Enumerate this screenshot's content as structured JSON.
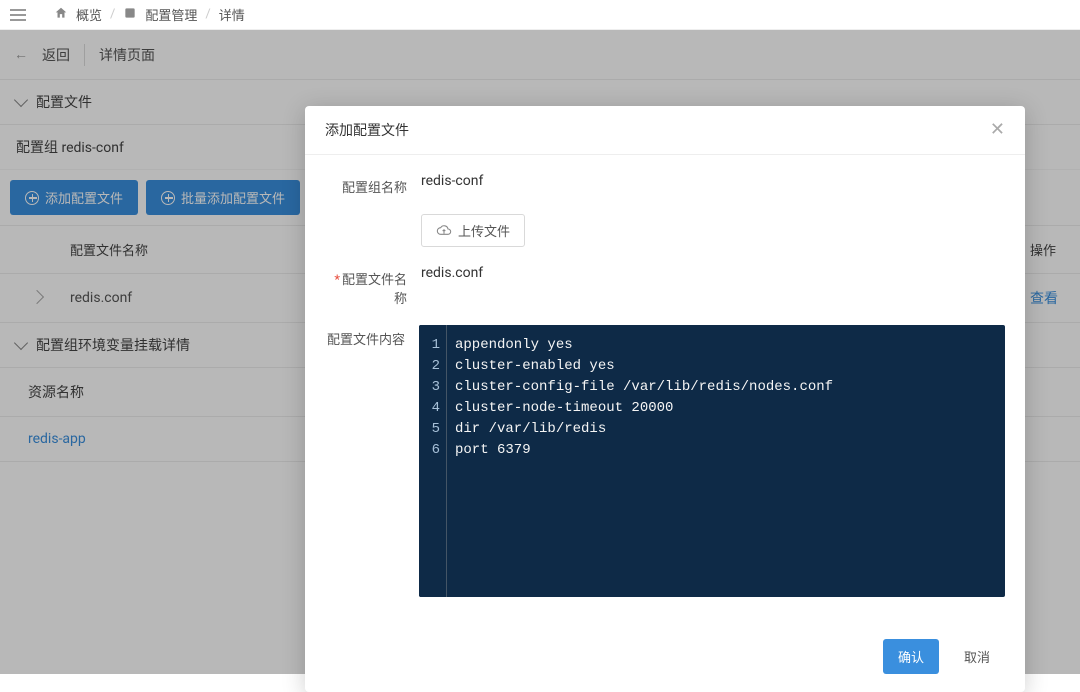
{
  "breadcrumb": {
    "overview": "概览",
    "config_mgmt": "配置管理",
    "detail": "详情"
  },
  "subheader": {
    "back": "返回",
    "title": "详情页面"
  },
  "sections": {
    "config_file_title": "配置文件",
    "config_group_label": "配置组 redis-conf",
    "env_mount_title": "配置组环境变量挂载详情"
  },
  "buttons": {
    "add_config_file": "添加配置文件",
    "batch_add_config_file": "批量添加配置文件"
  },
  "table": {
    "header_name": "配置文件名称",
    "header_ops": "操作",
    "rows": [
      {
        "name": "redis.conf",
        "view": "查看"
      }
    ]
  },
  "resource": {
    "header": "资源名称",
    "link": "redis-app"
  },
  "modal": {
    "title": "添加配置文件",
    "labels": {
      "group_name": "配置组名称",
      "file_name": "配置文件名称",
      "file_content": "配置文件内容"
    },
    "values": {
      "group_name": "redis-conf",
      "file_name": "redis.conf"
    },
    "upload": "上传文件",
    "code_lines": [
      "appendonly yes",
      "cluster-enabled yes",
      "cluster-config-file /var/lib/redis/nodes.conf",
      "cluster-node-timeout 20000",
      "dir /var/lib/redis",
      "port 6379"
    ],
    "footer": {
      "confirm": "确认",
      "cancel": "取消"
    }
  }
}
